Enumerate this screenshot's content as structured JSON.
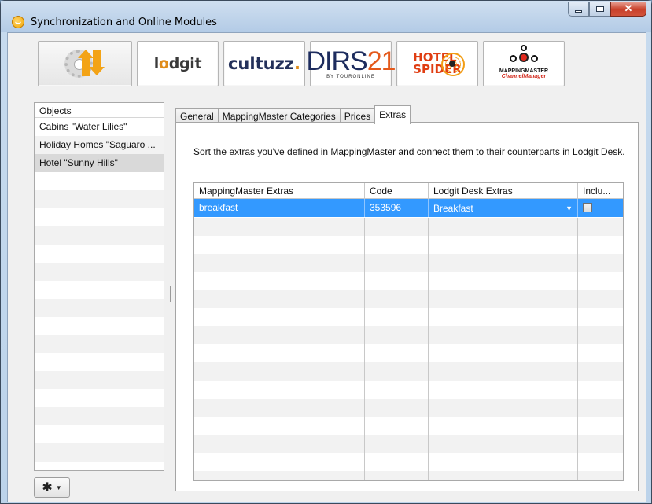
{
  "window": {
    "title": "Synchronization and Online Modules",
    "controls": {
      "minimize": "–",
      "maximize": "□",
      "close": "✕"
    }
  },
  "modules": [
    {
      "id": "sync",
      "icon": "sync-gear-arrows-icon"
    },
    {
      "id": "lodgit",
      "label_pre": "l",
      "label_o": "o",
      "label_post": "dgit"
    },
    {
      "id": "cultuzz",
      "label": "cultuzz",
      "dot": "."
    },
    {
      "id": "dirs21",
      "label_main": "DIRS",
      "label_num": "21",
      "label_sub": "BY TOURONLINE"
    },
    {
      "id": "hotelspider",
      "line1": "HOTEL",
      "line2": "SPIDER"
    },
    {
      "id": "mappingmaster",
      "line1": "MAPPINGMASTER",
      "line2": "ChannelManager"
    }
  ],
  "objects": {
    "header": "Objects",
    "items": [
      "Cabins \"Water Lilies\"",
      "Holiday Homes \"Saguaro ...",
      "Hotel \"Sunny Hills\""
    ],
    "selected_index": 2
  },
  "tabs": [
    {
      "label": "General",
      "active": false
    },
    {
      "label": "MappingMaster Categories",
      "active": false
    },
    {
      "label": "Prices",
      "active": false
    },
    {
      "label": "Extras",
      "active": true
    }
  ],
  "extras_panel": {
    "instructions": "Sort the extras you've defined in MappingMaster and connect them to their counterparts in Lodgit Desk.",
    "columns": [
      "MappingMaster Extras",
      "Code",
      "Lodgit Desk Extras",
      "Inclu..."
    ],
    "rows": [
      {
        "mm_extra": "breakfast",
        "code": "353596",
        "lodgit_extra": "Breakfast",
        "included": false,
        "selected": true
      }
    ]
  },
  "colors": {
    "selection": "#3399ff",
    "title_gradient_top": "#cfdff0",
    "close_button": "#c8412b"
  }
}
